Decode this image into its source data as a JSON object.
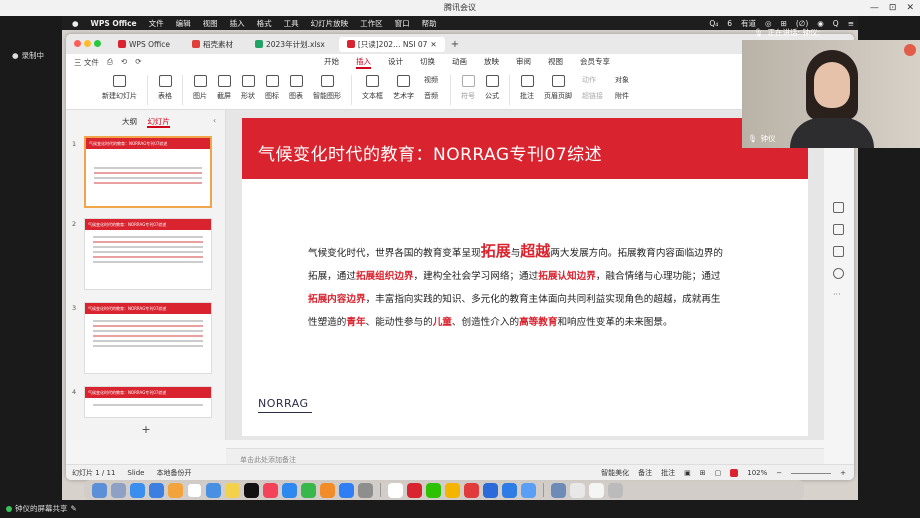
{
  "meeting": {
    "title": "腾讯会议",
    "record_label": "录制中",
    "share_label": "钟仪的屏幕共享",
    "speaking_label": "正在讲话: 钟仪;",
    "participant_name": "钟仪",
    "win_controls": [
      "—",
      "⊡",
      "✕"
    ]
  },
  "mac_menubar": {
    "items": [
      "WPS Office",
      "文件",
      "编辑",
      "视图",
      "插入",
      "格式",
      "工具",
      "幻灯片放映",
      "工作区",
      "窗口",
      "帮助"
    ],
    "right_items": [
      "Q₄",
      "6",
      "有道",
      "◎",
      "⊞",
      "(∅)",
      "◉",
      "Q",
      "≡"
    ]
  },
  "wps": {
    "tabs": [
      {
        "label": "WPS Office",
        "color": "#d9232e"
      },
      {
        "label": "稻壳素材",
        "color": "#e0403a"
      },
      {
        "label": "2023年计划.xlsx",
        "color": "#21a366"
      },
      {
        "label": "[只读]202… NSI 07",
        "color": "#d9232e",
        "active": true
      }
    ],
    "new_tab": "+",
    "ribbon_left": [
      "三 文件",
      "⎙",
      "⟲",
      "⟳"
    ],
    "ribbon_tabs": [
      "开始",
      "插入",
      "设计",
      "切换",
      "动画",
      "放映",
      "审阅",
      "视图",
      "会员专享"
    ],
    "ribbon_active": "插入",
    "ribbon_buttons": [
      "新建幻灯片",
      "表格",
      "图片",
      "截屏",
      "形状",
      "图标",
      "图表",
      "智能图形",
      "文本框",
      "艺术字"
    ],
    "ribbon_stack1": [
      "视频",
      "音频"
    ],
    "ribbon_formula": [
      "符号",
      "公式"
    ],
    "ribbon_tail": [
      "批注",
      "页眉页脚"
    ],
    "ribbon_stack2": [
      "动作",
      "超链接"
    ],
    "ribbon_stack3": [
      "对象",
      "附件"
    ],
    "pane_tabs": {
      "outline": "大纲",
      "slides": "幻灯片"
    },
    "thumb_title": "气候变化时代的教育：NORRAG专刊07综述",
    "slide_numbers": [
      "1",
      "2",
      "3",
      "4"
    ],
    "add_slide": "+",
    "notes_placeholder": "单击此处添加备注",
    "status": {
      "slide_counter": "幻灯片 1 / 11",
      "theme": "Slide",
      "backup": "本地备份开",
      "beautify": "智能美化",
      "notes": "备注",
      "comments": "批注",
      "zoom": "102%"
    }
  },
  "slide": {
    "title": "气候变化时代的教育：NORRAG专刊07综述",
    "body": [
      {
        "t": "气候变化时代，世界各国的教育变革呈现",
        "s": ""
      },
      {
        "t": "拓展",
        "s": "big"
      },
      {
        "t": "与",
        "s": ""
      },
      {
        "t": "超越",
        "s": "big"
      },
      {
        "t": "两大发展方向。拓展教育内容面临边界的拓展，通过",
        "s": ""
      },
      {
        "t": "拓展组织边界",
        "s": "hl"
      },
      {
        "t": "，建构全社会学习网络；通过",
        "s": ""
      },
      {
        "t": "拓展认知边界",
        "s": "hl"
      },
      {
        "t": "，融合情绪与心理功能；通过",
        "s": ""
      },
      {
        "t": "拓展内容边界",
        "s": "hl"
      },
      {
        "t": "，丰富指向实践的知识、多元化的教育主体面向共同利益实现角色的超越，成就再生性塑造的",
        "s": ""
      },
      {
        "t": "青年",
        "s": "hl"
      },
      {
        "t": "、能动性参与的",
        "s": ""
      },
      {
        "t": "儿童",
        "s": "hl"
      },
      {
        "t": "、创造性介入的",
        "s": ""
      },
      {
        "t": "高等教育",
        "s": "hl"
      },
      {
        "t": "和响应性变革的未来图景。",
        "s": ""
      }
    ],
    "logo": "NORRAG"
  },
  "colors": {
    "accent_red": "#d9232e",
    "menubar": "#1e1e1e",
    "dock": "#d2cdc8"
  }
}
